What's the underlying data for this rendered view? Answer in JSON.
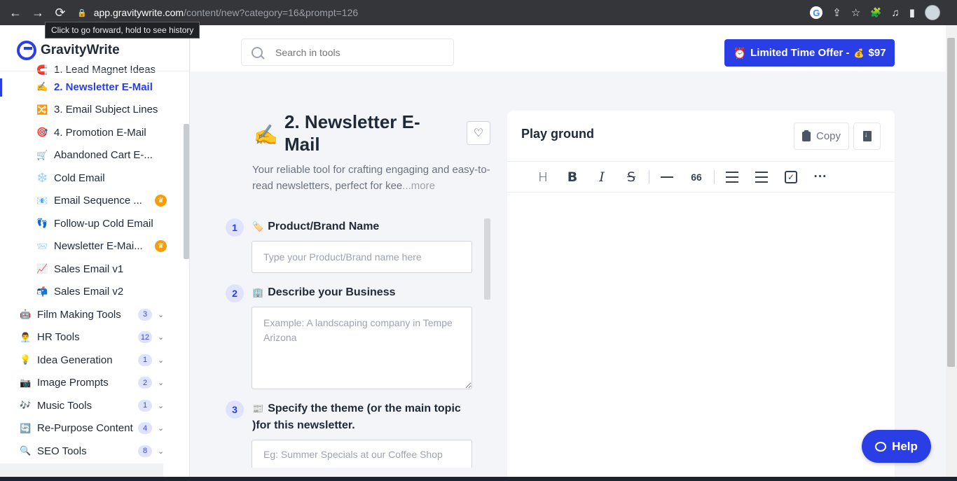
{
  "browser": {
    "url_host": "app.gravitywrite.com",
    "url_path": "/content/new?category=16&prompt=126",
    "tooltip": "Click to go forward, hold to see history",
    "back_glyph": "←",
    "forward_glyph": "→",
    "reload_glyph": "⟳",
    "lock_glyph": "🔒",
    "google_glyph": "G",
    "share_glyph": "⇪",
    "star_glyph": "☆",
    "puzzle_glyph": "🧩",
    "media_glyph": "♫",
    "side_glyph": "▮"
  },
  "app": {
    "logo_text": "GravityWrite",
    "search_placeholder": "Search in tools",
    "offer_alarm": "⏰",
    "offer_text": "Limited Time Offer -",
    "offer_bag": "💰",
    "offer_price": "$97"
  },
  "sidebar": {
    "items": [
      {
        "emoji": "🧲",
        "label": "1. Lead Magnet Ideas"
      },
      {
        "emoji": "✍️",
        "label": "2. Newsletter E-Mail"
      },
      {
        "emoji": "🔀",
        "label": "3. Email Subject Lines"
      },
      {
        "emoji": "🎯",
        "label": "4. Promotion E-Mail"
      },
      {
        "emoji": "🛒",
        "label": "Abandoned Cart E-..."
      },
      {
        "emoji": "❄️",
        "label": "Cold Email"
      },
      {
        "emoji": "📧",
        "label": "Email Sequence ..."
      },
      {
        "emoji": "👣",
        "label": "Follow-up Cold Email"
      },
      {
        "emoji": "📨",
        "label": "Newsletter E-Mai..."
      },
      {
        "emoji": "📈",
        "label": "Sales Email v1"
      },
      {
        "emoji": "📬",
        "label": "Sales Email v2"
      }
    ],
    "categories": [
      {
        "emoji": "🤖",
        "label": "Film Making Tools",
        "count": "3"
      },
      {
        "emoji": "👨‍💼",
        "label": "HR Tools",
        "count": "12"
      },
      {
        "emoji": "💡",
        "label": "Idea Generation",
        "count": "1"
      },
      {
        "emoji": "📷",
        "label": "Image Prompts",
        "count": "2"
      },
      {
        "emoji": "🎶",
        "label": "Music Tools",
        "count": "1"
      },
      {
        "emoji": "🔄",
        "label": "Re-Purpose Content",
        "count": "4"
      },
      {
        "emoji": "🔍",
        "label": "SEO Tools",
        "count": "8"
      }
    ],
    "crown_glyph": "♛",
    "chevron_glyph": "⌄"
  },
  "tool": {
    "emoji": "✍️",
    "title": "2. Newsletter E-Mail",
    "heart_glyph": "♡",
    "description": "Your reliable tool for crafting engaging and easy-to-read newsletters, perfect for kee",
    "more_label": "...more",
    "questions": [
      {
        "number": "1",
        "emoji": "🏷️",
        "label": "Product/Brand Name",
        "placeholder": "Type your Product/Brand name here"
      },
      {
        "number": "2",
        "emoji": "🏢",
        "label": "Describe your Business",
        "placeholder": "Example: A landscaping company in Tempe Arizona"
      },
      {
        "number": "3",
        "emoji": "📰",
        "label": "Specify the theme (or the main topic )for this newsletter.",
        "placeholder": "Eg: Summer Specials at our Coffee Shop"
      }
    ]
  },
  "playground": {
    "title": "Play ground",
    "copy_label": "Copy",
    "toolbar": {
      "heading": "H",
      "bold": "B",
      "italic": "I",
      "strike": "S",
      "quote": "66",
      "ordered": "1",
      "more": "···",
      "check": "✓"
    }
  },
  "help_label": "Help"
}
